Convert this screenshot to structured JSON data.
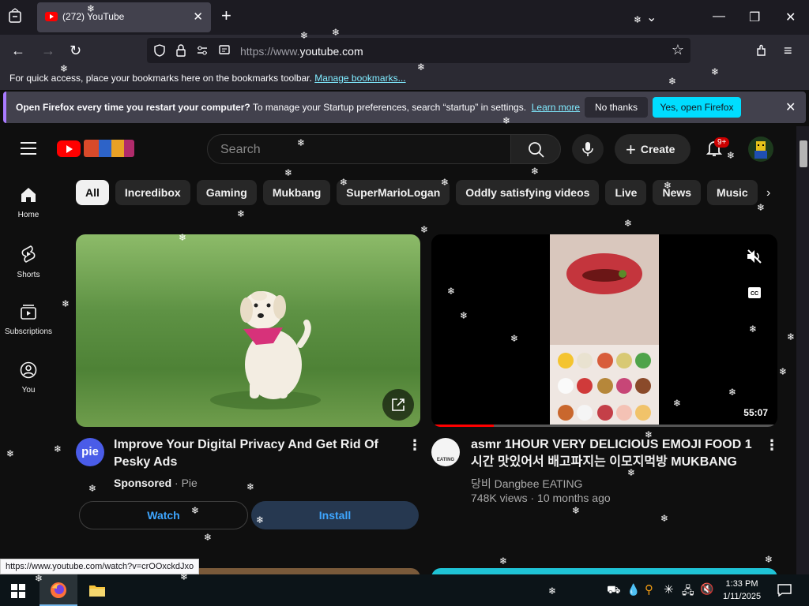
{
  "browser": {
    "tab_title": "(272) YouTube",
    "url_prefix": "https://www.",
    "url_domain": "youtube.com",
    "bookmarks_text": "For quick access, place your bookmarks here on the bookmarks toolbar.",
    "bookmarks_link": "Manage bookmarks...",
    "infobar_bold": "Open Firefox every time you restart your computer?",
    "infobar_text": "To manage your Startup preferences, search “startup” in settings.",
    "infobar_link": "Learn more",
    "no_thanks": "No thanks",
    "yes_open": "Yes, open Firefox",
    "status_url": "https://www.youtube.com/watch?v=crOOxckdJxo"
  },
  "youtube": {
    "search_placeholder": "Search",
    "create_label": "Create",
    "notif_badge": "9+",
    "sidebar": [
      {
        "label": "Home"
      },
      {
        "label": "Shorts"
      },
      {
        "label": "Subscriptions"
      },
      {
        "label": "You"
      }
    ],
    "chips": [
      "All",
      "Incredibox",
      "Gaming",
      "Mukbang",
      "SuperMarioLogan",
      "Oddly satisfying videos",
      "Live",
      "News",
      "Music"
    ],
    "ad": {
      "channel_logo": "pie",
      "title": "Improve Your Digital Privacy And Get Rid Of Pesky Ads",
      "sponsored": "Sponsored",
      "sponsor": "Pie",
      "watch": "Watch",
      "install": "Install"
    },
    "video": {
      "title": "asmr 1HOUR VERY DELICIOUS EMOJI FOOD 1시간 맛있어서 배고파지는 이모지먹방 MUKBANG eati…",
      "channel": "당비 Dangbee EATING",
      "views": "748K views",
      "age": "10 months ago",
      "duration": "55:07",
      "avatar_text": "EATING",
      "progress": 0.18
    }
  },
  "taskbar": {
    "time": "1:33 PM",
    "date": "1/11/2025"
  },
  "colors": {
    "yt_red": "#ff0000",
    "firefox_accent": "#00ddff",
    "link_blue": "#3ea6ff"
  }
}
